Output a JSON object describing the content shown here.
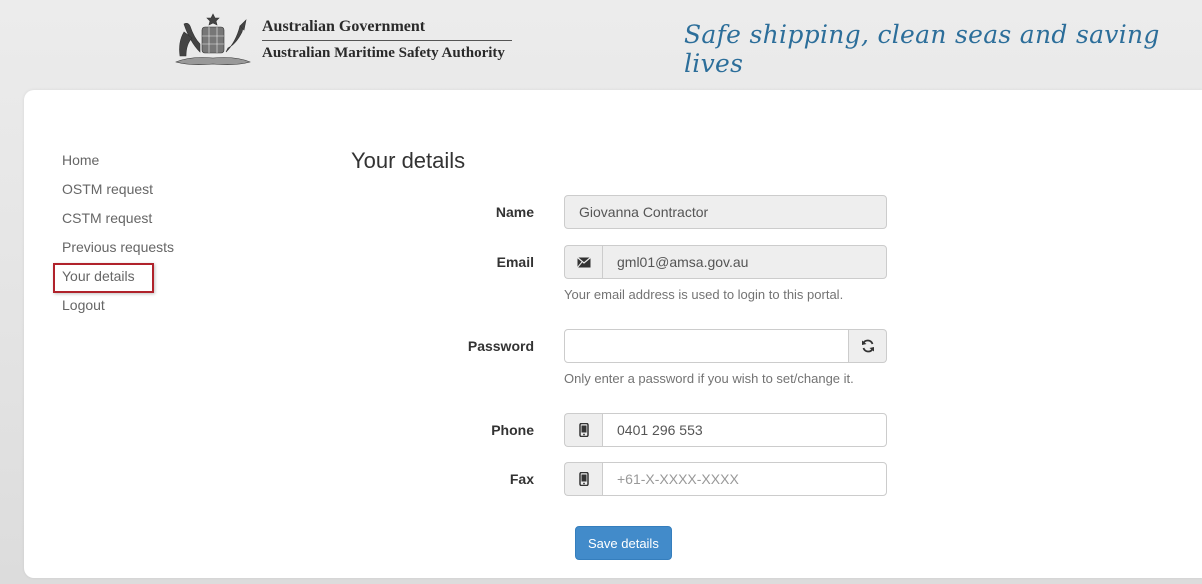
{
  "header": {
    "gov_name": "Australian Government",
    "authority_name": "Australian Maritime Safety Authority",
    "tagline": "Safe shipping, clean seas and saving lives",
    "crest_icon": "coat-of-arms-icon"
  },
  "nav": {
    "items": [
      {
        "label": "Home"
      },
      {
        "label": "OSTM request"
      },
      {
        "label": "CSTM request"
      },
      {
        "label": "Previous requests"
      },
      {
        "label": "Your details"
      },
      {
        "label": "Logout"
      }
    ],
    "active_index": 4
  },
  "form": {
    "title": "Your details",
    "name": {
      "label": "Name",
      "value": "Giovanna Contractor"
    },
    "email": {
      "label": "Email",
      "value": "gml01@amsa.gov.au",
      "icon": "envelope-icon",
      "help": "Your email address is used to login to this portal."
    },
    "password": {
      "label": "Password",
      "value": "",
      "icon": "refresh-icon",
      "help": "Only enter a password if you wish to set/change it."
    },
    "phone": {
      "label": "Phone",
      "value": "0401 296 553",
      "icon": "mobile-phone-icon"
    },
    "fax": {
      "label": "Fax",
      "value": "",
      "placeholder": "+61-X-XXXX-XXXX",
      "icon": "mobile-phone-icon"
    },
    "save_label": "Save details"
  },
  "colors": {
    "primary_button": "#428bca",
    "tagline": "#2c6e9a",
    "active_highlight": "#b0222b"
  }
}
